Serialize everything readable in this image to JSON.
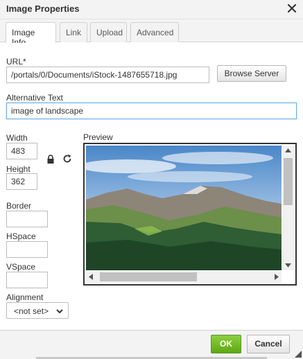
{
  "dialog": {
    "title": "Image Properties"
  },
  "tabs": [
    {
      "label": "Image Info",
      "active": true
    },
    {
      "label": "Link",
      "active": false
    },
    {
      "label": "Upload",
      "active": false
    },
    {
      "label": "Advanced",
      "active": false
    }
  ],
  "url": {
    "label": "URL*",
    "value": "/portals/0/Documents/iStock-1487655718.jpg",
    "browse_label": "Browse Server"
  },
  "alt_text": {
    "label": "Alternative Text",
    "value": "image of landscape"
  },
  "width": {
    "label": "Width",
    "value": "483"
  },
  "height": {
    "label": "Height",
    "value": "362"
  },
  "border": {
    "label": "Border",
    "value": ""
  },
  "hspace": {
    "label": "HSpace",
    "value": ""
  },
  "vspace": {
    "label": "VSpace",
    "value": ""
  },
  "alignment": {
    "label": "Alignment",
    "selected": "<not set>"
  },
  "preview": {
    "label": "Preview"
  },
  "footer": {
    "ok_label": "OK",
    "cancel_label": "Cancel"
  },
  "colors": {
    "ok_green": "#6bb82a",
    "focus_blue": "#66afe9",
    "title_bg": "#f3f3f3"
  },
  "icons": {
    "close": "close-icon",
    "lock": "lock-icon",
    "reset": "reset-size-icon",
    "resize": "resize-handle-icon"
  }
}
